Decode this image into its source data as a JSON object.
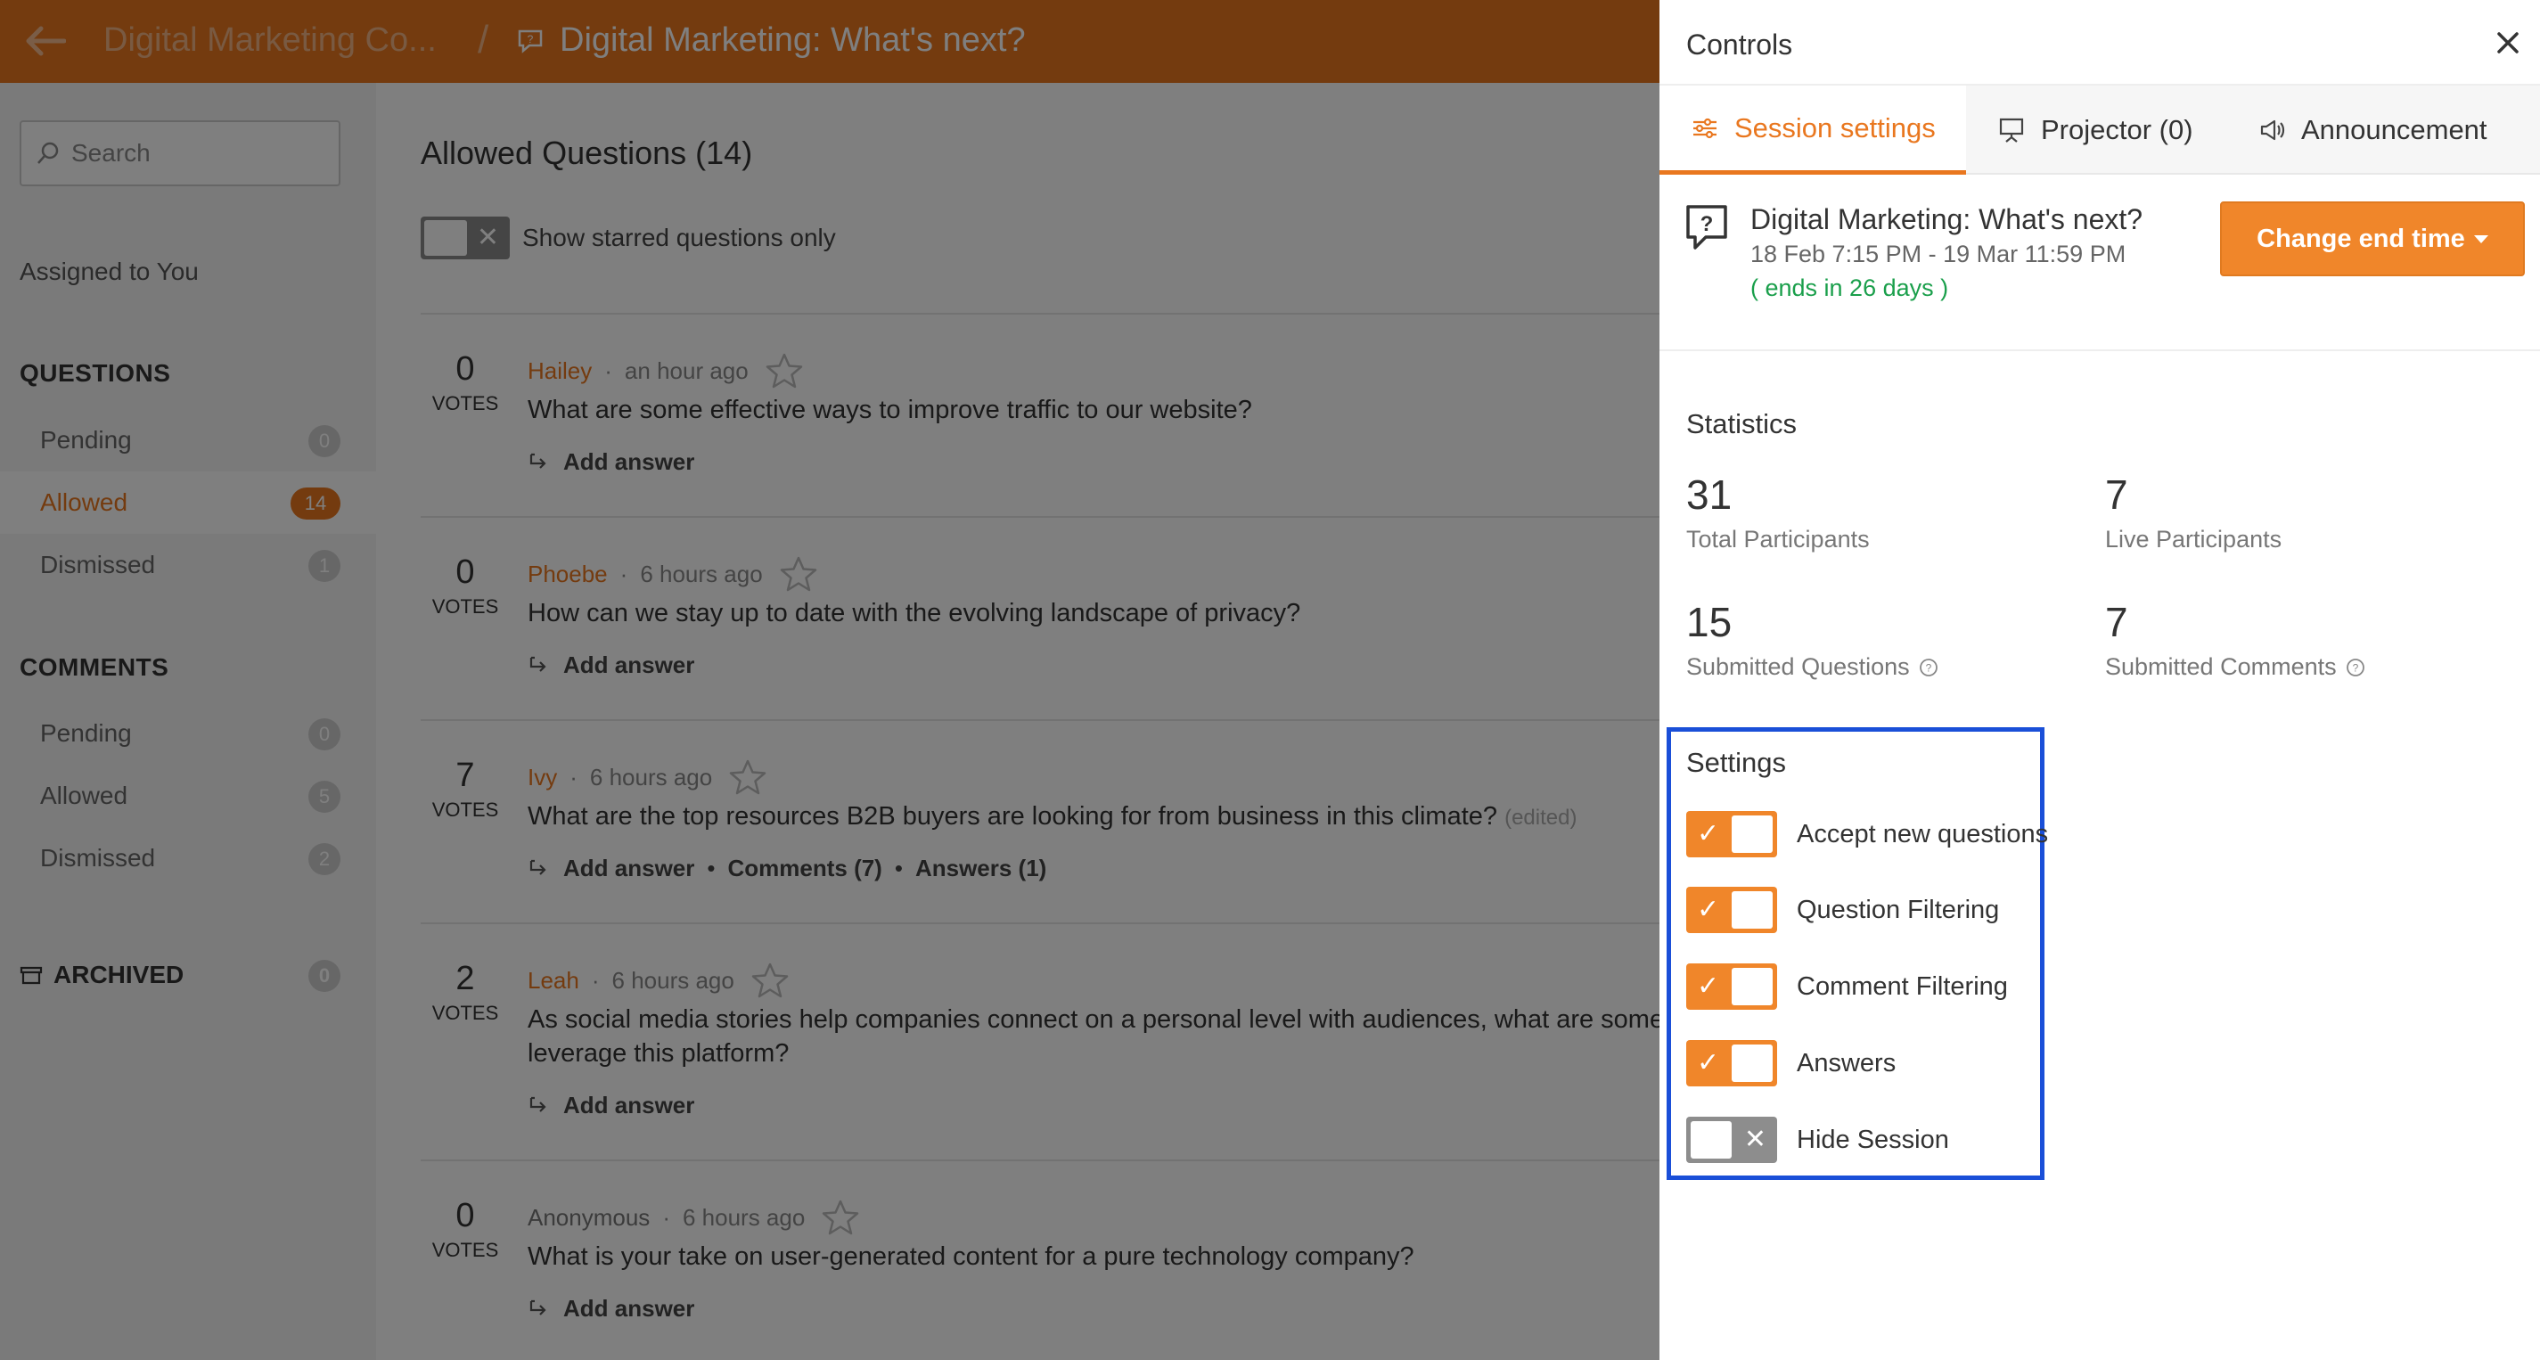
{
  "header": {
    "back_icon": "arrow-left-icon",
    "parent_crumb": "Digital Marketing Co...",
    "separator": "/",
    "current_crumb": "Digital Marketing: What's next?"
  },
  "sidebar": {
    "search_placeholder": "Search",
    "assigned": "Assigned to You",
    "questions_heading": "QUESTIONS",
    "questions": [
      {
        "label": "Pending",
        "count": "0"
      },
      {
        "label": "Allowed",
        "count": "14"
      },
      {
        "label": "Dismissed",
        "count": "1"
      }
    ],
    "comments_heading": "COMMENTS",
    "comments": [
      {
        "label": "Pending",
        "count": "0"
      },
      {
        "label": "Allowed",
        "count": "5"
      },
      {
        "label": "Dismissed",
        "count": "2"
      }
    ],
    "archived_label": "ARCHIVED",
    "archived_count": "0"
  },
  "main": {
    "title": "Allowed Questions (14)",
    "starred_label": "Show starred questions only",
    "votes_label": "VOTES",
    "add_answer": "Add answer",
    "questions": [
      {
        "votes": "0",
        "author": "Hailey",
        "time": "an hour ago",
        "text": "What are some effective ways to improve traffic to our website?"
      },
      {
        "votes": "0",
        "author": "Phoebe",
        "time": "6 hours ago",
        "text": "How can we stay up to date with the evolving landscape of privacy?"
      },
      {
        "votes": "7",
        "author": "Ivy",
        "time": "6 hours ago",
        "text": "What are the top resources B2B buyers are looking for from business in this climate?",
        "edited": "(edited)",
        "comments": "Comments (7)",
        "answers": "Answers (1)"
      },
      {
        "votes": "2",
        "author": "Leah",
        "time": "6 hours ago",
        "text": "As social media stories help companies connect on a personal level with audiences, what are some wa",
        "text2": "leverage this platform?"
      },
      {
        "votes": "0",
        "author": "Anonymous",
        "time": "6 hours ago",
        "text": "What is your take on user-generated content for a pure technology company?"
      }
    ]
  },
  "panel": {
    "title": "Controls",
    "close_icon": "close-icon",
    "tabs": [
      {
        "label": "Session settings",
        "icon": "sliders-icon",
        "active": true
      },
      {
        "label": "Projector (0)",
        "icon": "projector-icon",
        "active": false
      },
      {
        "label": "Announcement",
        "icon": "megaphone-icon",
        "active": false
      }
    ],
    "session": {
      "name": "Digital Marketing: What's next?",
      "dates": "18 Feb 7:15 PM - 19 Mar 11:59 PM",
      "ends": "( ends in 26 days )"
    },
    "change_end_label": "Change end time",
    "statistics_title": "Statistics",
    "stats": [
      {
        "value": "31",
        "label": "Total Participants"
      },
      {
        "value": "7",
        "label": "Live Participants"
      },
      {
        "value": "15",
        "label": "Submitted Questions"
      },
      {
        "value": "7",
        "label": "Submitted Comments"
      }
    ],
    "settings_title": "Settings",
    "settings": [
      {
        "label": "Accept new questions",
        "on": true
      },
      {
        "label": "Question Filtering",
        "on": true
      },
      {
        "label": "Comment Filtering",
        "on": true
      },
      {
        "label": "Answers",
        "on": true
      },
      {
        "label": "Hide Session",
        "on": false
      }
    ]
  },
  "colors": {
    "accent": "#e9771f",
    "ends_green": "#1a9f4b",
    "highlight_blue": "#1a4fd8"
  }
}
